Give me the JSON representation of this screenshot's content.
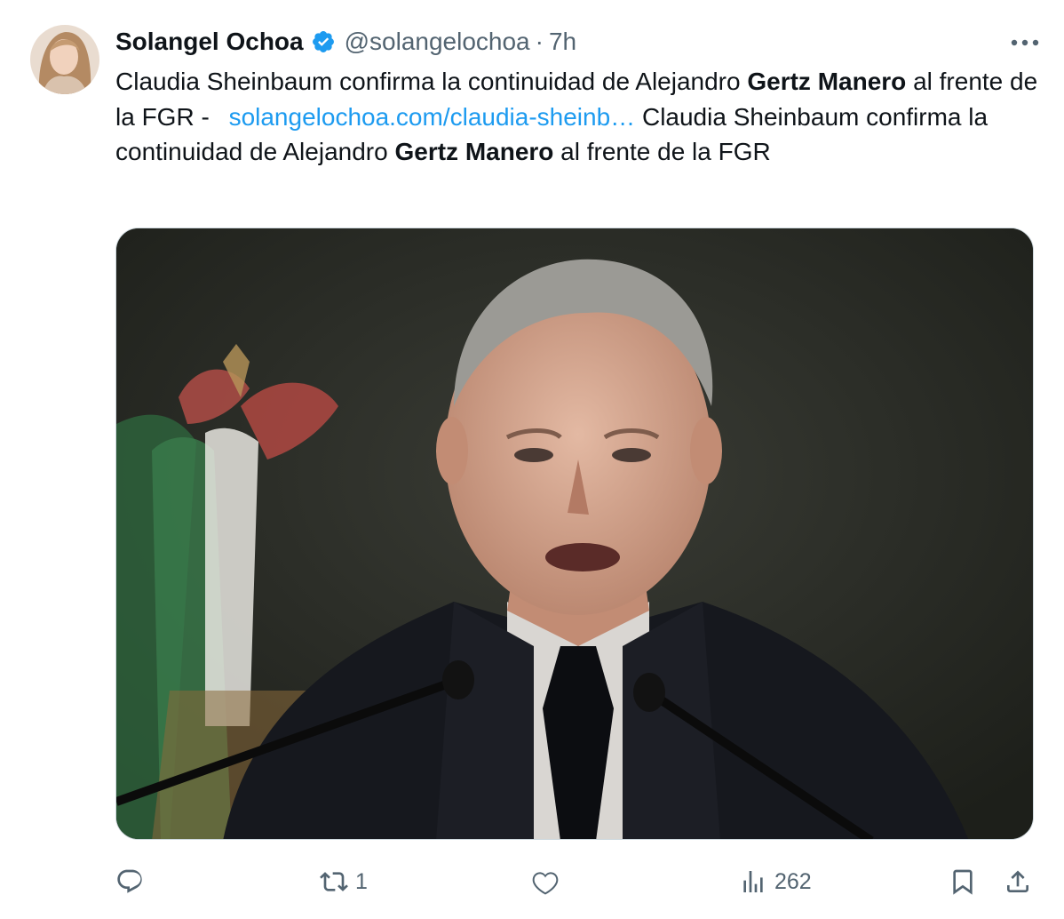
{
  "author": {
    "name": "Solangel Ochoa",
    "handle": "@solangelochoa",
    "separator": "·",
    "time": "7h",
    "verified_icon": "verified-badge-icon",
    "colors": {
      "verified": "#1d9bf0",
      "muted": "#536471"
    }
  },
  "tweet": {
    "part1": "Claudia Sheinbaum confirma la continuidad de Alejandro ",
    "bold1": "Gertz Manero",
    "part2": " al frente de la FGR - ",
    "link": "solangelochoa.com/claudia-sheinb…",
    "part3": " Claudia Sheinbaum confirma la continuidad de Alejandro ",
    "bold2": "Gertz Manero",
    "part4": " al frente de la FGR"
  },
  "actions": {
    "reply": {
      "icon": "reply-icon",
      "count": ""
    },
    "retweet": {
      "icon": "retweet-icon",
      "count": "1"
    },
    "like": {
      "icon": "heart-icon",
      "count": ""
    },
    "views": {
      "icon": "views-icon",
      "count": "262"
    },
    "bookmark": {
      "icon": "bookmark-icon"
    },
    "share": {
      "icon": "share-icon"
    }
  },
  "menu": {
    "icon": "more-icon"
  },
  "link_color": "#1d9bf0"
}
